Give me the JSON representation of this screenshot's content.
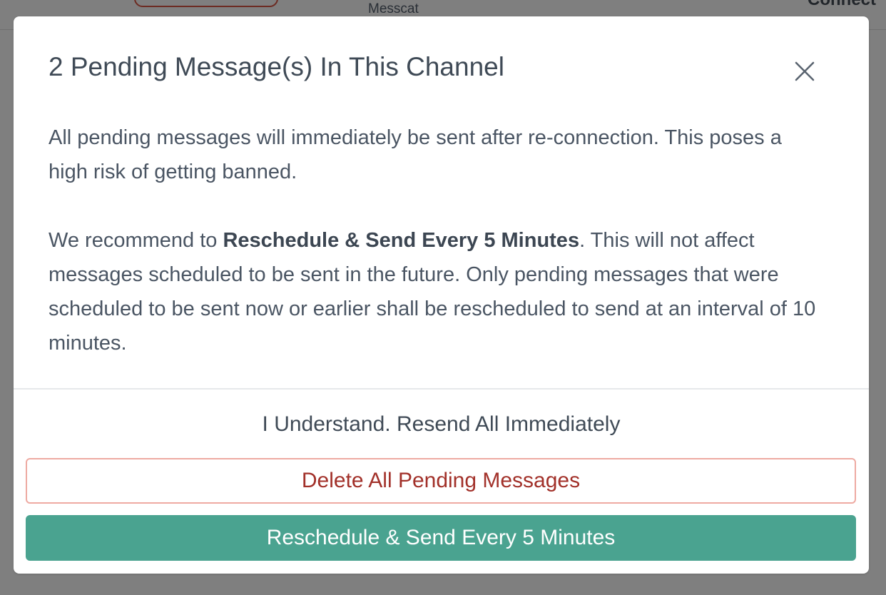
{
  "background": {
    "header_label": "Messcat",
    "header_right_text": "Connect"
  },
  "modal": {
    "title": "2 Pending Message(s) In This Channel",
    "body": {
      "paragraph1": "All pending messages will immediately be sent after re-connection. This poses a high risk of getting banned.",
      "paragraph2_prefix": "We recommend to ",
      "paragraph2_bold": "Reschedule & Send Every 5 Minutes",
      "paragraph2_suffix": ". This will not affect messages scheduled to be sent in the future. Only pending messages that were scheduled to be sent now or earlier shall be rescheduled to send at an interval of 10 minutes."
    },
    "buttons": {
      "resend_all": "I Understand. Resend All Immediately",
      "delete_all": "Delete All Pending Messages",
      "reschedule": "Reschedule & Send Every 5 Minutes"
    },
    "icons": {
      "close": "close-icon"
    }
  },
  "colors": {
    "overlay": "#7f7f7f",
    "title_text": "#3f4a56",
    "body_text": "#4a5563",
    "danger_text": "#a2312a",
    "danger_border": "#eeaaa2",
    "primary": "#4aa390"
  }
}
